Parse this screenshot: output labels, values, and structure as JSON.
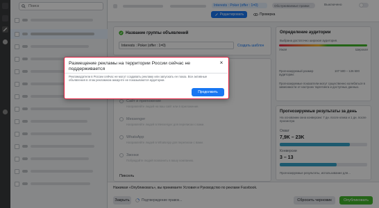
{
  "sidebar": {
    "search_placeholder": "Поиск"
  },
  "topbar": {
    "campaign_name": "Interests : Poker (offer : 1=0)",
    "status_label": "Обслуживаемые правки",
    "toggle_label": "Выключено",
    "edit_label": "Редактировать",
    "preview_label": "Проверка"
  },
  "adset": {
    "section_title": "Название группы объявлений",
    "name_value": "Interests : Poker (offer : 1=0)",
    "create_template_label": "Создать шаблон",
    "conversion_options": [
      {
        "title": "Сайт и приложение",
        "desc": "Направляйте людей на ваш сайт или в приложение."
      },
      {
        "title": "Messenger",
        "desc": "Направляйте людей в Messenger для переписки с вами."
      },
      {
        "title": "WhatsApp",
        "desc": "Направляйте людей в WhatsApp для переписки с вами."
      },
      {
        "title": "Звонки",
        "desc": "Побуждайте людей позвонить в вашу компанию."
      }
    ],
    "pixel_label": "Пиксель"
  },
  "audience": {
    "title": "Определение аудитории",
    "subtitle": "Выбрана достаточно широкая аудитория.",
    "narrow_label": "Узкая",
    "wide_label": "Широкая",
    "size_label": "Прогнозируемый размер аудитории:",
    "size_value": "107 500 – 126 500",
    "note": "Прогнозируемые показатели могут существенно колебаться в зависимости от настроек таргетинга и доступных данных."
  },
  "forecast": {
    "title": "Прогнозируемые результаты за день",
    "subtitle": "На основании окна конверсии: 7 дн. после клика и 1 дн. после просмотра",
    "reach_label": "Охват",
    "reach_value": "7,9K – 23K",
    "reach_fill": 0.8,
    "conv_label": "Конверсии",
    "conv_value": "3 – 13",
    "conv_fill": 0.65,
    "note": "Прогнозируемые результаты, использование для..."
  },
  "bottom": {
    "terms_text": "Нажимая «Опубликовать», вы принимаете Условия и Руководство по рекламе Facebook.",
    "close_label": "Закрыть",
    "saving_label": "Подтверждение правок...",
    "discard_label": "Сбросить черновик",
    "publish_label": "Опубликовать"
  },
  "modal": {
    "title": "Размещение рекламы на территории России сейчас не поддерживается",
    "body": "Рекламодатели в России сейчас не могут создавать рекламу или запускать ее показ. Все активные объявления в этом рекламном аккаунте не показываются аудитории.",
    "continue_label": "Продолжить",
    "close_glyph": "×"
  },
  "colors": {
    "primary": "#1877f2",
    "publish": "#42b72a",
    "modal_border": "#e41e3f"
  }
}
